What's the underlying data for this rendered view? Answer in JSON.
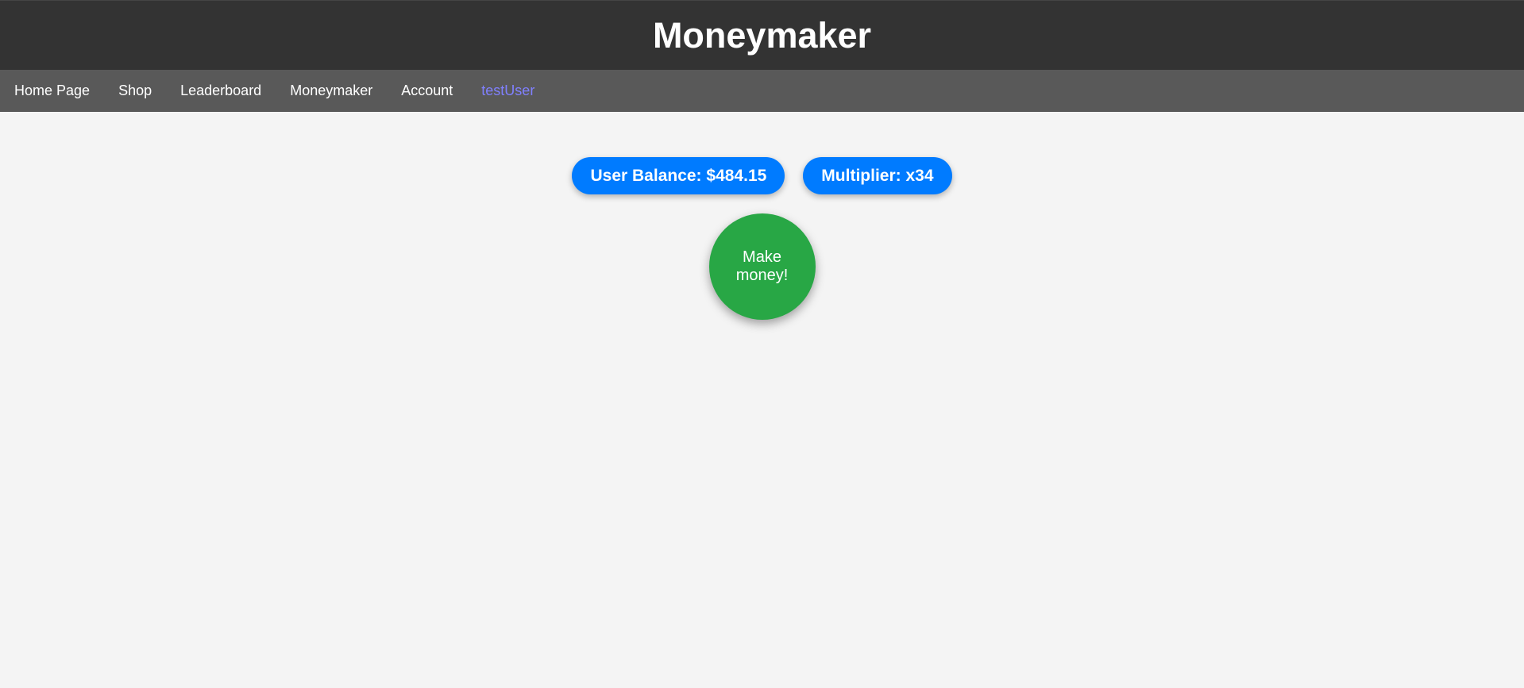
{
  "header": {
    "title": "Moneymaker"
  },
  "nav": {
    "items": [
      {
        "label": "Home Page"
      },
      {
        "label": "Shop"
      },
      {
        "label": "Leaderboard"
      },
      {
        "label": "Moneymaker"
      },
      {
        "label": "Account"
      },
      {
        "label": "testUser"
      }
    ]
  },
  "stats": {
    "balance": "User Balance: $484.15",
    "multiplier": "Multiplier: x34"
  },
  "action": {
    "make_money_label": "Make money!"
  },
  "colors": {
    "header_bg": "#333333",
    "nav_bg": "#595959",
    "pill_blue": "#007bff",
    "button_green": "#28a745",
    "user_link": "#8080ff"
  }
}
